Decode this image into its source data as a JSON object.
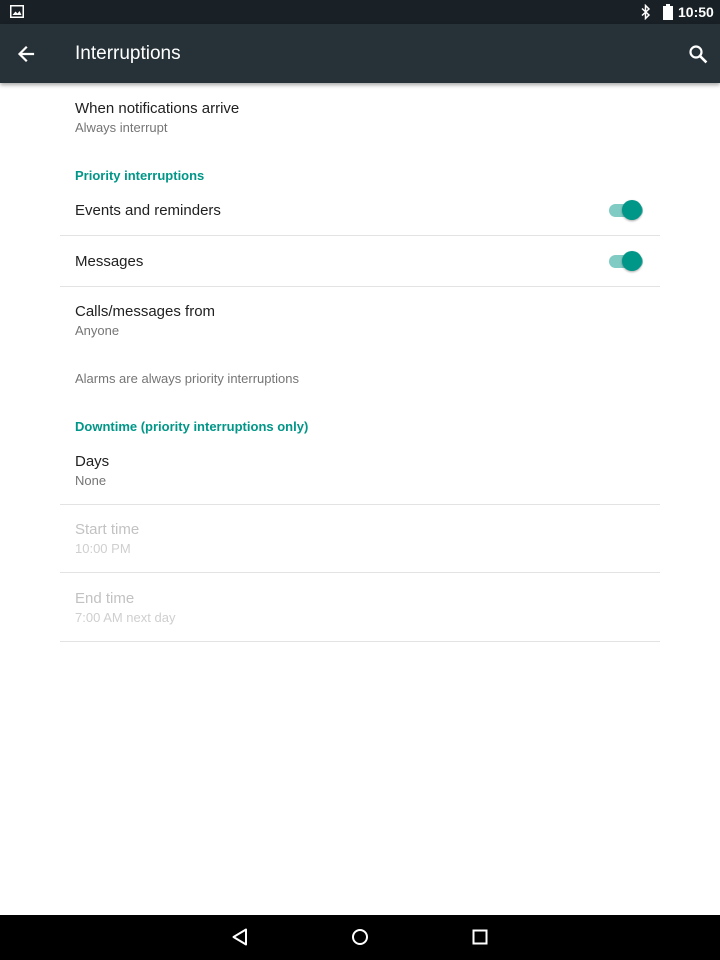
{
  "status_bar": {
    "clock": "10:50",
    "icons": [
      "image-notification-icon",
      "bluetooth-icon",
      "battery-icon"
    ]
  },
  "app_bar": {
    "title": "Interruptions",
    "back_icon": "arrow-back-icon",
    "search_icon": "search-icon",
    "background": "#263238"
  },
  "settings": {
    "when_notifications": {
      "title": "When notifications arrive",
      "summary": "Always interrupt"
    },
    "priority_header": "Priority interruptions",
    "events": {
      "title": "Events and reminders",
      "enabled": true
    },
    "messages": {
      "title": "Messages",
      "enabled": true
    },
    "calls_from": {
      "title": "Calls/messages from",
      "summary": "Anyone"
    },
    "alarms_note": "Alarms are always priority interruptions",
    "downtime_header": "Downtime (priority interruptions only)",
    "days": {
      "title": "Days",
      "summary": "None"
    },
    "start_time": {
      "title": "Start time",
      "summary": "10:00 PM",
      "disabled": true
    },
    "end_time": {
      "title": "End time",
      "summary": "7:00 AM next day",
      "disabled": true
    }
  },
  "nav_bar": {
    "buttons": [
      "back-triangle-icon",
      "home-circle-icon",
      "recents-square-icon"
    ]
  },
  "colors": {
    "accent": "#009688",
    "accent_track": "#80cbc4",
    "primary_text": "#212121",
    "secondary_text": "#757575"
  }
}
